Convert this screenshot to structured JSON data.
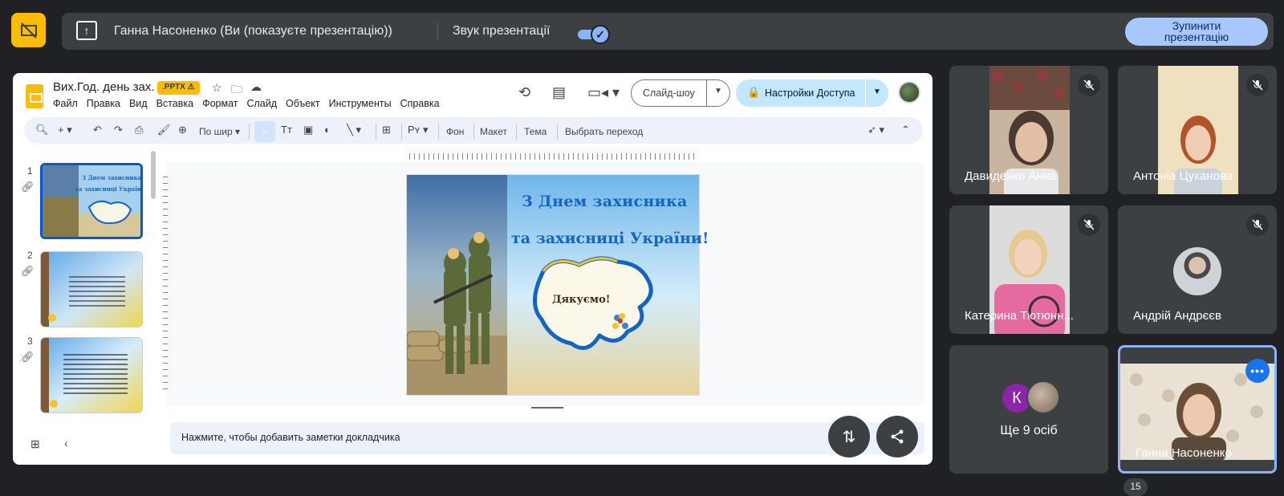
{
  "present_bar": {
    "presenter_text": "Ганна Насоненко (Ви (показуєте презентацію))",
    "sound_label": "Звук презентації",
    "sound_on": true,
    "stop_line1": "Зупинити",
    "stop_line2": "презентацію"
  },
  "doc": {
    "title": "Вих.Год. день зах.",
    "badge": ".PPTX",
    "menu": [
      "Файл",
      "Правка",
      "Вид",
      "Вставка",
      "Формат",
      "Слайд",
      "Объект",
      "Инструменты",
      "Справка"
    ],
    "slideshow_label": "Слайд-шоу",
    "share_label": "Настройки Доступа"
  },
  "toolbar": {
    "zoom_label": "По шир",
    "bg_label": "Фон",
    "layout_label": "Макет",
    "theme_label": "Тема",
    "transition_label": "Выбрать переход"
  },
  "filmstrip": {
    "slides": [
      {
        "num": "1"
      },
      {
        "num": "2"
      },
      {
        "num": "3"
      }
    ]
  },
  "slide": {
    "title_line1": "З Днем захисника",
    "title_line2": "та захисниці України!",
    "map_text": "Дякуємо!"
  },
  "notes": {
    "placeholder": "Нажмите, чтобы добавить заметки докладчика"
  },
  "participants": [
    {
      "name": "Давиденко Анна",
      "muted": true
    },
    {
      "name": "Антоніа Цуканова",
      "muted": true
    },
    {
      "name": "Катерина Тютюнн...",
      "muted": true
    },
    {
      "name": "Андрій Андрєєв",
      "muted": true
    },
    {
      "name": "Ганна Насоненко",
      "muted": false
    }
  ],
  "more_tile": {
    "avatar_letter": "К",
    "label": "Ще 9 осіб"
  },
  "count_badge": "15",
  "colors": {
    "accent": "#8ab4f8",
    "stop_button": "#a8c7fa",
    "slides_brand": "#fbbc04",
    "tile_bg": "#3c4043"
  }
}
